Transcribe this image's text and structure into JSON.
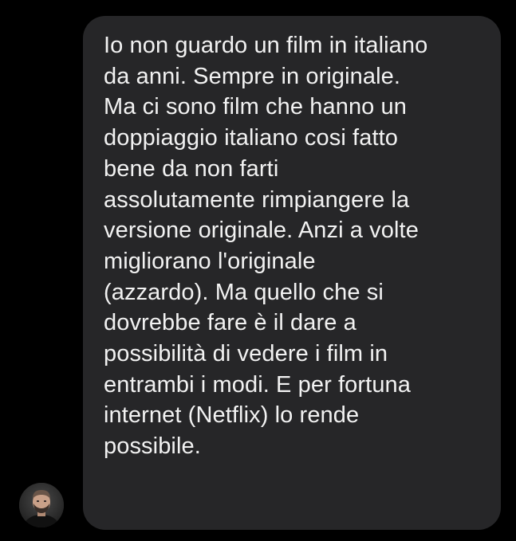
{
  "conversation": {
    "sender": {
      "avatar_icon": "user-avatar-photo"
    },
    "message": {
      "lines": [
        "Io non guardo un film in italiano",
        "da anni. Sempre in originale.",
        "Ma ci sono film che hanno un",
        "doppiaggio italiano cosi fatto",
        "bene da non farti",
        "assolutamente rimpiangere la",
        "versione originale. Anzi a volte",
        "migliorano l'originale",
        "(azzardo). Ma quello che si",
        "dovrebbe fare è il dare a",
        "possibilità di vedere i film in",
        "entrambi i modi. E per fortuna",
        "internet (Netflix) lo rende",
        "possibile."
      ]
    }
  },
  "colors": {
    "background": "#000000",
    "bubble": "#262628",
    "text": "#f2f2f2"
  }
}
